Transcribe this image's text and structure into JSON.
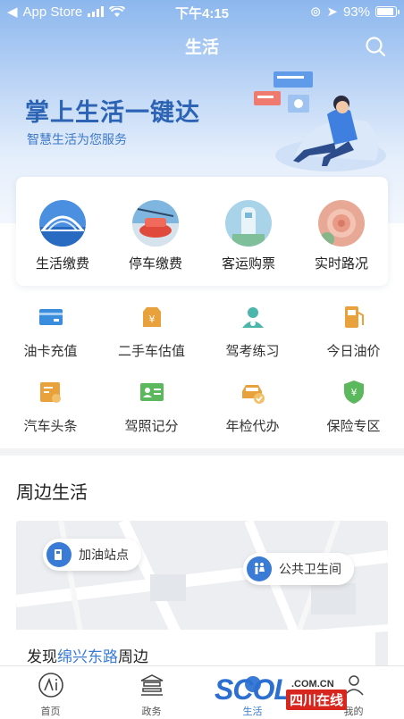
{
  "status": {
    "carrier": "App Store",
    "time": "下午4:15",
    "battery": "93%",
    "battery_level": 0.93
  },
  "navbar": {
    "title": "生活"
  },
  "hero": {
    "title": "掌上生活一键达",
    "subtitle": "智慧生活为您服务"
  },
  "card": {
    "items": [
      {
        "label": "生活缴费",
        "icon": "bridge-photo-icon"
      },
      {
        "label": "停车缴费",
        "icon": "parking-photo-icon"
      },
      {
        "label": "客运购票",
        "icon": "bus-ticket-photo-icon"
      },
      {
        "label": "实时路况",
        "icon": "traffic-photo-icon"
      }
    ]
  },
  "grid": {
    "rows": [
      [
        {
          "label": "油卡充值",
          "icon": "fuel-card-icon",
          "color": "#3a8ddc"
        },
        {
          "label": "二手车估值",
          "icon": "used-car-value-icon",
          "color": "#e9a23b"
        },
        {
          "label": "驾考练习",
          "icon": "driving-test-icon",
          "color": "#4db6ac"
        },
        {
          "label": "今日油价",
          "icon": "fuel-price-icon",
          "color": "#e9a23b"
        }
      ],
      [
        {
          "label": "汽车头条",
          "icon": "car-news-icon",
          "color": "#e9a23b"
        },
        {
          "label": "驾照记分",
          "icon": "license-points-icon",
          "color": "#5cb85c"
        },
        {
          "label": "年检代办",
          "icon": "annual-inspection-icon",
          "color": "#e9a23b"
        },
        {
          "label": "保险专区",
          "icon": "insurance-icon",
          "color": "#5cb85c"
        }
      ]
    ]
  },
  "nearby": {
    "title": "周边生活",
    "pins": [
      {
        "label": "加油站点"
      },
      {
        "label": "公共卫生间"
      }
    ],
    "find_prefix": "发现",
    "find_road": "绵兴东路",
    "find_suffix": "周边"
  },
  "tabs": [
    {
      "label": "首页"
    },
    {
      "label": "政务"
    },
    {
      "label": "生活"
    },
    {
      "label": "我的"
    }
  ],
  "watermark": {
    "brand": "SCOL",
    "domain": ".COM.CN",
    "cn": "四川在线"
  },
  "colors": {
    "accent": "#3a7bd5",
    "hero_title": "#2c63b5"
  }
}
